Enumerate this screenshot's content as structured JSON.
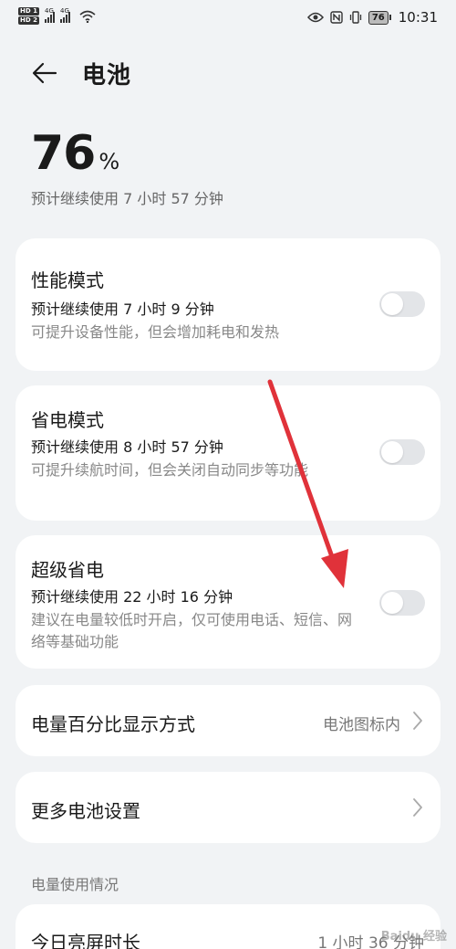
{
  "status_bar": {
    "hd1": "HD 1",
    "hd2": "HD 2",
    "sig_label": "4G",
    "battery_level": "76",
    "time": "10:31"
  },
  "header": {
    "title": "电池"
  },
  "battery": {
    "percent": "76",
    "percent_sign": "%",
    "remaining": "预计继续使用 7 小时 57 分钟"
  },
  "modes": [
    {
      "title": "性能模式",
      "estimate": "预计继续使用 7 小时 9 分钟",
      "description": "可提升设备性能，但会增加耗电和发热",
      "enabled": false
    },
    {
      "title": "省电模式",
      "estimate": "预计继续使用 8 小时 57 分钟",
      "description": "可提升续航时间，但会关闭自动同步等功能",
      "enabled": false
    },
    {
      "title": "超级省电",
      "estimate": "预计继续使用 22 小时 16 分钟",
      "description": "建议在电量较低时开启，仅可使用电话、短信、网络等基础功能",
      "enabled": false
    }
  ],
  "percentage_display": {
    "label": "电量百分比显示方式",
    "value": "电池图标内"
  },
  "more_settings": {
    "label": "更多电池设置"
  },
  "usage": {
    "section_label": "电量使用情况",
    "screen_on_label": "今日亮屏时长",
    "screen_on_value": "1 小时 36 分钟"
  },
  "watermark": "Baidu 经验",
  "colors": {
    "background": "#f1f3f5",
    "card": "#ffffff",
    "toggle_off": "#e3e5e8",
    "annotation_arrow": "#e0323a"
  }
}
